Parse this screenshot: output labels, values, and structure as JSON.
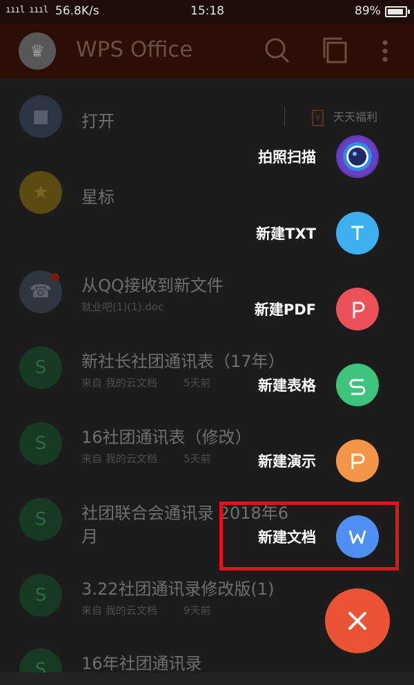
{
  "status_bar": {
    "signal": " ̱il 4G il",
    "speed": "56.8K/s",
    "time": "15:18",
    "battery": "89%"
  },
  "app_bar": {
    "title": "WPS Office"
  },
  "list": {
    "open_label": "打开",
    "welfare_label": "天天福利",
    "star_label": "星标",
    "qq_label": "从QQ接收到新文件",
    "qq_file": "就业吧(1)(1).doc",
    "files": [
      {
        "name": "新社长社团通讯表（17年）",
        "source": "来自 我的云文档",
        "time": "5天前"
      },
      {
        "name": "16社团通讯表（修改）",
        "source": "来自 我的云文档",
        "time": "5天前"
      },
      {
        "name": "社团联合会通讯录 2018年6",
        "name_line2": "月"
      },
      {
        "name": "3.22社团通讯录修改版(1)",
        "source": "来自 我的云文档",
        "time": "9天前"
      },
      {
        "name": "16年社团通讯录"
      }
    ]
  },
  "fab_menu": {
    "items": [
      {
        "label": "拍照扫描",
        "color": "#5d3bb8"
      },
      {
        "label": "新建TXT",
        "color": "#3fb0ef"
      },
      {
        "label": "新建PDF",
        "color": "#ec5058"
      },
      {
        "label": "新建表格",
        "color": "#3ec37c"
      },
      {
        "label": "新建演示",
        "color": "#f39447"
      },
      {
        "label": "新建文档",
        "color": "#4f8ef3"
      }
    ],
    "close_color": "#ea5434"
  },
  "colors": {
    "highlight": "#e0141a",
    "app_bar_bg": "#2d0e06"
  }
}
